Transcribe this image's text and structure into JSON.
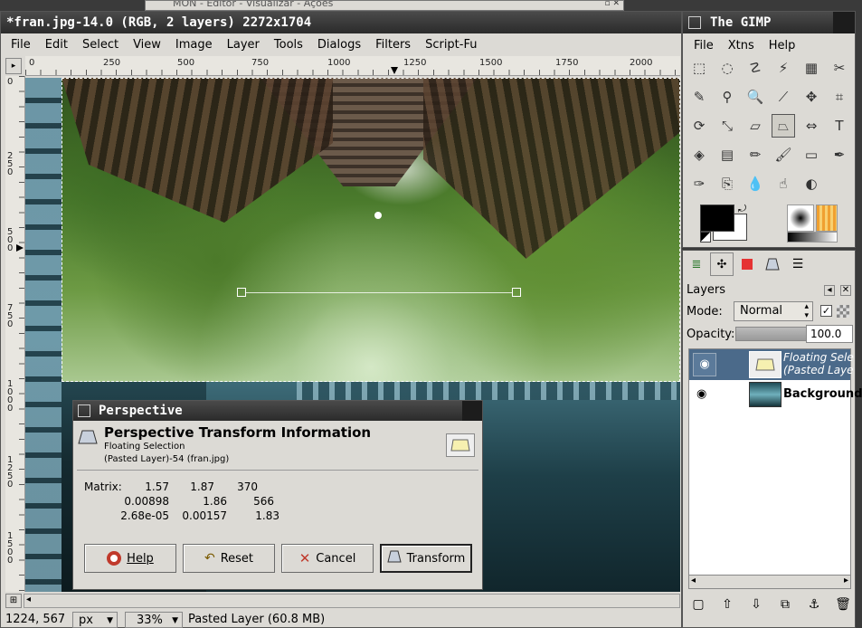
{
  "background_window": {
    "title": "MON - Editor - Visualizar - Ações"
  },
  "image_window": {
    "title": "*fran.jpg-14.0 (RGB, 2 layers) 2272x1704",
    "menu": [
      "File",
      "Edit",
      "Select",
      "View",
      "Image",
      "Layer",
      "Tools",
      "Dialogs",
      "Filters",
      "Script-Fu"
    ],
    "hruler": [
      "0",
      "250",
      "500",
      "750",
      "1000",
      "1250",
      "1500",
      "1750",
      "2000"
    ],
    "vruler": [
      "0",
      "250",
      "500",
      "750",
      "1000",
      "1250",
      "1500"
    ],
    "status": {
      "coords": "1224, 567",
      "unit": "px",
      "zoom": "33%",
      "message": "Pasted Layer (60.8 MB)"
    }
  },
  "dialog": {
    "title": "Perspective",
    "heading": "Perspective Transform Information",
    "subtitle": "Floating Selection",
    "subtitle2": "(Pasted Layer)-54 (fran.jpg)",
    "matrix_label": "Matrix:",
    "matrix": [
      [
        "1.57",
        "1.87",
        "370"
      ],
      [
        "0.00898",
        "1.86",
        "566"
      ],
      [
        "2.68e-05",
        "0.00157",
        "1.83"
      ]
    ],
    "buttons": {
      "help": "Help",
      "reset": "Reset",
      "cancel": "Cancel",
      "transform": "Transform"
    }
  },
  "toolbox": {
    "title": "The GIMP",
    "menu": [
      "File",
      "Xtns",
      "Help"
    ],
    "tool_icons": [
      "rect-select-icon",
      "ellipse-select-icon",
      "free-select-icon",
      "fuzzy-select-icon",
      "select-by-color-icon",
      "scissors-icon",
      "paths-icon",
      "color-picker-icon",
      "zoom-icon",
      "measure-icon",
      "move-icon",
      "crop-icon",
      "rotate-icon",
      "scale-icon",
      "shear-icon",
      "perspective-icon",
      "flip-icon",
      "text-icon",
      "bucket-fill-icon",
      "blend-icon",
      "pencil-icon",
      "paintbrush-icon",
      "eraser-icon",
      "airbrush-icon",
      "ink-icon",
      "clone-icon",
      "convolve-icon",
      "smudge-icon",
      "dodge-burn-icon"
    ],
    "colors": {
      "fg": "#000000",
      "bg": "#ffffff"
    }
  },
  "layers": {
    "title": "Layers",
    "mode_label": "Mode:",
    "mode_value": "Normal",
    "opacity_label": "Opacity:",
    "opacity_value": "100.0",
    "items": [
      {
        "name": "Floating Sele",
        "name2": "(Pasted Laye"
      },
      {
        "name": "Background"
      }
    ]
  }
}
